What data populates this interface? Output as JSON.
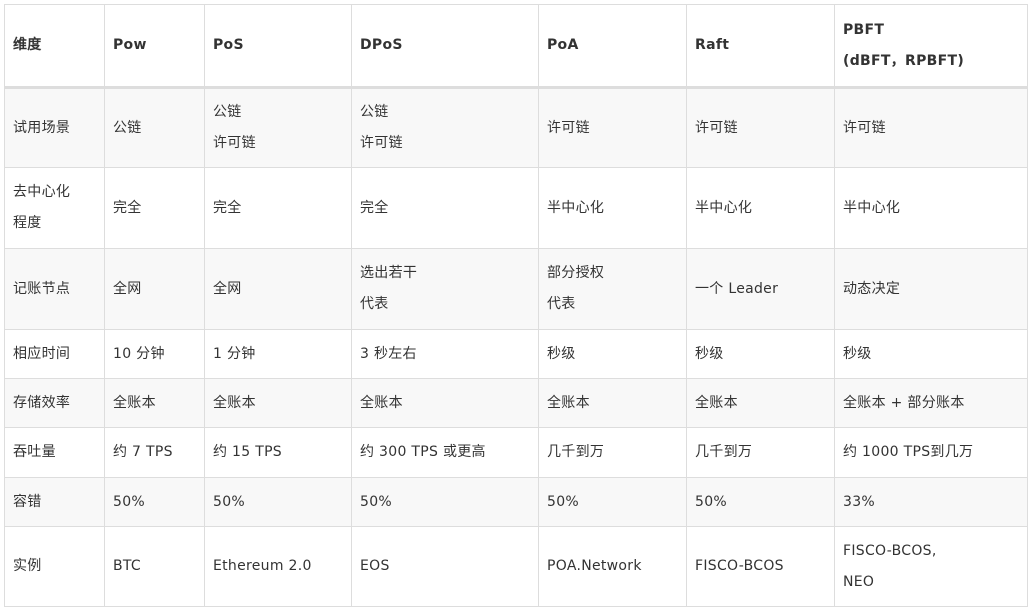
{
  "table": {
    "headers": [
      [
        "维度"
      ],
      [
        "Pow"
      ],
      [
        "PoS"
      ],
      [
        "DPoS"
      ],
      [
        "PoA"
      ],
      [
        "Raft"
      ],
      [
        "PBFT",
        "(dBFT，RPBFT)"
      ]
    ],
    "rows": [
      {
        "label": [
          "试用场景"
        ],
        "cells": [
          [
            "公链"
          ],
          [
            "公链",
            "许可链"
          ],
          [
            "公链",
            "许可链"
          ],
          [
            "许可链"
          ],
          [
            "许可链"
          ],
          [
            "许可链"
          ]
        ]
      },
      {
        "label": [
          "去中心化",
          "程度"
        ],
        "cells": [
          [
            "完全"
          ],
          [
            "完全"
          ],
          [
            "完全"
          ],
          [
            "半中心化"
          ],
          [
            "半中心化"
          ],
          [
            "半中心化"
          ]
        ]
      },
      {
        "label": [
          "记账节点"
        ],
        "cells": [
          [
            "全网"
          ],
          [
            "全网"
          ],
          [
            "选出若干",
            "代表"
          ],
          [
            "部分授权",
            "代表"
          ],
          [
            "一个 Leader"
          ],
          [
            "动态决定"
          ]
        ]
      },
      {
        "label": [
          "相应时间"
        ],
        "cells": [
          [
            "10 分钟"
          ],
          [
            "1 分钟"
          ],
          [
            "3 秒左右"
          ],
          [
            "秒级"
          ],
          [
            "秒级"
          ],
          [
            "秒级"
          ]
        ]
      },
      {
        "label": [
          "存储效率"
        ],
        "cells": [
          [
            "全账本"
          ],
          [
            "全账本"
          ],
          [
            "全账本"
          ],
          [
            "全账本"
          ],
          [
            "全账本"
          ],
          [
            "全账本 + 部分账本"
          ]
        ]
      },
      {
        "label": [
          "吞吐量"
        ],
        "cells": [
          [
            "约 7 TPS"
          ],
          [
            "约 15 TPS"
          ],
          [
            "约 300 TPS 或更高"
          ],
          [
            "几千到万"
          ],
          [
            "几千到万"
          ],
          [
            "约 1000 TPS到几万"
          ]
        ]
      },
      {
        "label": [
          "容错"
        ],
        "cells": [
          [
            "50%"
          ],
          [
            "50%"
          ],
          [
            "50%"
          ],
          [
            "50%"
          ],
          [
            "50%"
          ],
          [
            "33%"
          ]
        ]
      },
      {
        "label": [
          "实例"
        ],
        "cells": [
          [
            "BTC"
          ],
          [
            "Ethereum 2.0"
          ],
          [
            "EOS"
          ],
          [
            "POA.Network"
          ],
          [
            "FISCO-BCOS"
          ],
          [
            "FISCO-BCOS,",
            "NEO"
          ]
        ]
      }
    ]
  }
}
